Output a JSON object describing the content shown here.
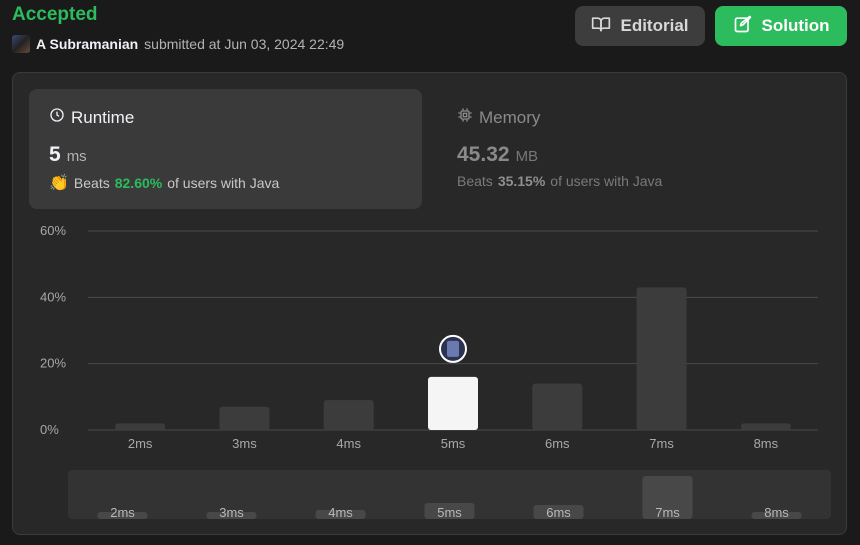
{
  "header": {
    "status": "Accepted",
    "user": "A Subramanian",
    "submitted_text": "submitted at Jun 03, 2024 22:49"
  },
  "buttons": {
    "editorial": "Editorial",
    "solution": "Solution"
  },
  "runtime": {
    "title": "Runtime",
    "value": "5",
    "unit": "ms",
    "beats_label": "Beats",
    "beats_pct": "82.60%",
    "beats_suffix": "of users with Java"
  },
  "memory": {
    "title": "Memory",
    "value": "45.32",
    "unit": "MB",
    "beats_label": "Beats",
    "beats_pct": "35.15%",
    "beats_suffix": "of users with Java"
  },
  "colors": {
    "accent_green": "#2cbb5d",
    "bar": "#3c3c3c",
    "bar_selected": "#f5f5f5",
    "grid": "#4a4a4a"
  },
  "chart_data": {
    "type": "bar",
    "categories": [
      "2ms",
      "3ms",
      "4ms",
      "5ms",
      "6ms",
      "7ms",
      "8ms"
    ],
    "values": [
      2,
      7,
      9,
      16,
      14,
      43,
      2
    ],
    "selected_category": "5ms",
    "yticks": [
      "0%",
      "20%",
      "40%",
      "60%"
    ],
    "ylim": [
      0,
      60
    ],
    "grid": true
  }
}
